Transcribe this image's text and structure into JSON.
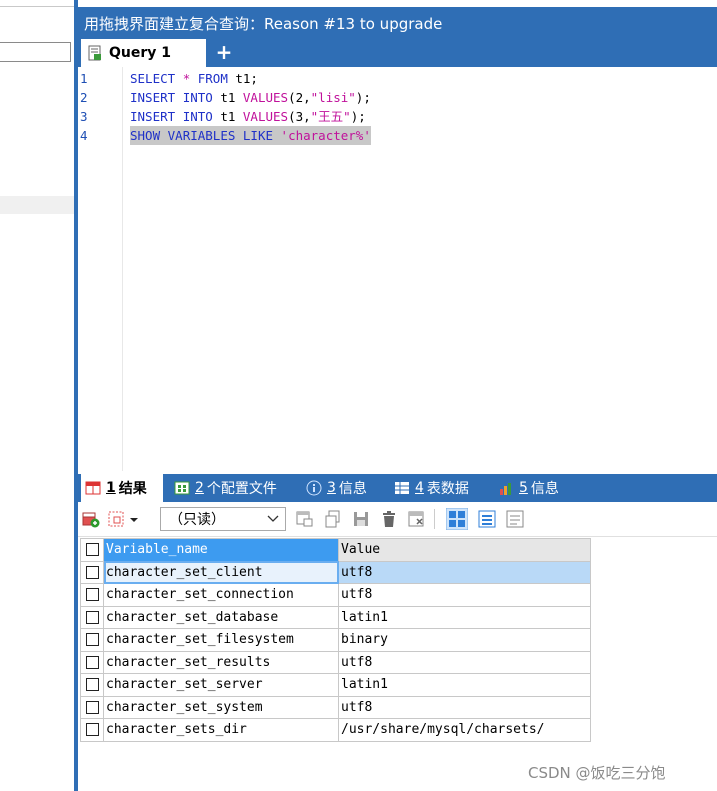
{
  "window": {
    "title": "用拖拽界面建立复合查询：Reason #13 to upgrade"
  },
  "tabs": {
    "query_tab_label": "Query 1",
    "new_tab_label": "+"
  },
  "editor": {
    "lines": [
      {
        "num": "1",
        "parts": [
          {
            "t": "SELECT",
            "c": "kw"
          },
          {
            "t": " ",
            "c": "id"
          },
          {
            "t": "*",
            "c": "fn"
          },
          {
            "t": " ",
            "c": "id"
          },
          {
            "t": "FROM",
            "c": "kw"
          },
          {
            "t": " t1;",
            "c": "id"
          }
        ]
      },
      {
        "num": "2",
        "parts": [
          {
            "t": "INSERT",
            "c": "kw"
          },
          {
            "t": " ",
            "c": "id"
          },
          {
            "t": "INTO",
            "c": "kw"
          },
          {
            "t": " t1 ",
            "c": "id"
          },
          {
            "t": "VALUES",
            "c": "fn"
          },
          {
            "t": "(2,",
            "c": "id"
          },
          {
            "t": "\"lisi\"",
            "c": "str"
          },
          {
            "t": ");",
            "c": "id"
          }
        ]
      },
      {
        "num": "3",
        "parts": [
          {
            "t": "INSERT",
            "c": "kw"
          },
          {
            "t": " ",
            "c": "id"
          },
          {
            "t": "INTO",
            "c": "kw"
          },
          {
            "t": " t1 ",
            "c": "id"
          },
          {
            "t": "VALUES",
            "c": "fn"
          },
          {
            "t": "(3,",
            "c": "id"
          },
          {
            "t": "\"王五\"",
            "c": "str"
          },
          {
            "t": ");",
            "c": "id"
          }
        ]
      },
      {
        "num": "4",
        "highlight": true,
        "parts": [
          {
            "t": "SHOW",
            "c": "kw"
          },
          {
            "t": " ",
            "c": "id"
          },
          {
            "t": "VARIABLES",
            "c": "kw"
          },
          {
            "t": " ",
            "c": "id"
          },
          {
            "t": "LIKE",
            "c": "kw"
          },
          {
            "t": " ",
            "c": "id"
          },
          {
            "t": "'character%'",
            "c": "str"
          }
        ]
      }
    ]
  },
  "result_tabs": [
    {
      "num": "1",
      "label": "结果",
      "icon": "grid-icon"
    },
    {
      "num": "2",
      "label": "个配置文件",
      "icon": "profile-icon"
    },
    {
      "num": "3",
      "label": "信息",
      "icon": "info-icon"
    },
    {
      "num": "4",
      "label": "表数据",
      "icon": "table-data-icon"
    },
    {
      "num": "5",
      "label": "信息",
      "icon": "info-chart-icon"
    }
  ],
  "toolbar": {
    "readonly_label": "（只读）"
  },
  "grid": {
    "columns": [
      "Variable_name",
      "Value"
    ],
    "rows": [
      [
        "character_set_client",
        "utf8"
      ],
      [
        "character_set_connection",
        "utf8"
      ],
      [
        "character_set_database",
        "latin1"
      ],
      [
        "character_set_filesystem",
        "binary"
      ],
      [
        "character_set_results",
        "utf8"
      ],
      [
        "character_set_server",
        "latin1"
      ],
      [
        "character_set_system",
        "utf8"
      ],
      [
        "character_sets_dir",
        "/usr/share/mysql/charsets/"
      ]
    ],
    "selected_row": 0
  },
  "colors": {
    "accent": "#2f6eb5",
    "header_selected": "#3d9bf0",
    "keyword": "#1f31c8",
    "string": "#c0119b"
  },
  "watermark": "CSDN @饭吃三分饱"
}
